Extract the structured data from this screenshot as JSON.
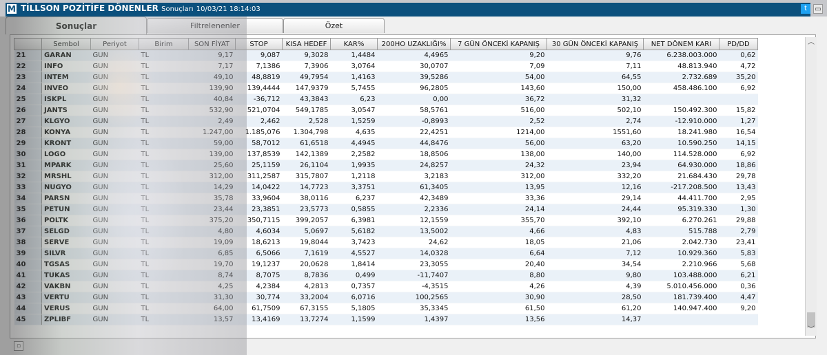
{
  "window": {
    "logo": "M",
    "title": "TİLLSON POZİTİFE DÖNENLER",
    "subtitle": "Sonuçları",
    "datetime": "10/03/21 18:14:03",
    "twitter_icon": "twitter-icon",
    "minimize_icon": "minimize-icon"
  },
  "tabs": [
    {
      "label": "Sonuçlar",
      "active": true
    },
    {
      "label": "Filtrelenenler",
      "active": false
    },
    {
      "label": "Özet",
      "active": false
    }
  ],
  "table": {
    "columns": [
      "",
      "Sembol",
      "Periyot",
      "Birim",
      "SON FİYAT",
      "STOP",
      "KISA HEDEF",
      "KAR%",
      "200HO UZAKLIĞI%",
      "7 GÜN ÖNCEKİ KAPANIŞ",
      "30 GÜN ÖNCEKİ KAPANIŞ",
      "NET DÖNEM KARI",
      "PD/DD"
    ],
    "rows": [
      [
        "21",
        "GARAN",
        "GUN",
        "TL",
        "9,17",
        "9,087",
        "9,3028",
        "1,4484",
        "4,4965",
        "9,20",
        "9,76",
        "6.238.003.000",
        "0,62"
      ],
      [
        "22",
        "INFO",
        "GUN",
        "TL",
        "7,17",
        "7,1386",
        "7,3906",
        "3,0764",
        "30,0707",
        "7,09",
        "7,11",
        "48.813.940",
        "4,72"
      ],
      [
        "23",
        "INTEM",
        "GUN",
        "TL",
        "49,10",
        "48,8819",
        "49,7954",
        "1,4163",
        "39,5286",
        "54,00",
        "64,55",
        "2.732.689",
        "35,20"
      ],
      [
        "24",
        "INVEO",
        "GUN",
        "TL",
        "139,90",
        "139,4444",
        "147,9379",
        "5,7455",
        "96,2805",
        "143,60",
        "150,00",
        "458.486.100",
        "6,92"
      ],
      [
        "25",
        "ISKPL",
        "GUN",
        "TL",
        "40,84",
        "-36,712",
        "43,3843",
        "6,23",
        "0,00",
        "36,72",
        "31,32",
        "",
        ""
      ],
      [
        "26",
        "JANTS",
        "GUN",
        "TL",
        "532,90",
        "521,0704",
        "549,1785",
        "3,0547",
        "58,5761",
        "516,00",
        "502,10",
        "150.492.300",
        "15,82"
      ],
      [
        "27",
        "KLGYO",
        "GUN",
        "TL",
        "2,49",
        "2,462",
        "2,528",
        "1,5259",
        "-0,8993",
        "2,52",
        "2,74",
        "-12.910.000",
        "1,27"
      ],
      [
        "28",
        "KONYA",
        "GUN",
        "TL",
        "1.247,00",
        "1.185,076",
        "1.304,798",
        "4,635",
        "22,4251",
        "1214,00",
        "1551,60",
        "18.241.980",
        "16,54"
      ],
      [
        "29",
        "KRONT",
        "GUN",
        "TL",
        "59,00",
        "58,7012",
        "61,6518",
        "4,4945",
        "44,8476",
        "56,00",
        "63,20",
        "10.590.250",
        "14,15"
      ],
      [
        "30",
        "LOGO",
        "GUN",
        "TL",
        "139,00",
        "137,8539",
        "142,1389",
        "2,2582",
        "18,8506",
        "138,00",
        "140,00",
        "114.528.000",
        "6,92"
      ],
      [
        "31",
        "MPARK",
        "GUN",
        "TL",
        "25,60",
        "25,1159",
        "26,1104",
        "1,9935",
        "24,8257",
        "24,32",
        "23,94",
        "64.930.000",
        "18,86"
      ],
      [
        "32",
        "MRSHL",
        "GUN",
        "TL",
        "312,00",
        "311,2587",
        "315,7807",
        "1,2118",
        "3,2183",
        "312,00",
        "332,20",
        "21.684.430",
        "29,78"
      ],
      [
        "33",
        "NUGYO",
        "GUN",
        "TL",
        "14,29",
        "14,0422",
        "14,7723",
        "3,3751",
        "61,3405",
        "13,95",
        "12,16",
        "-217.208.500",
        "13,43"
      ],
      [
        "34",
        "PARSN",
        "GUN",
        "TL",
        "35,78",
        "33,9604",
        "38,0116",
        "6,237",
        "42,3489",
        "33,36",
        "29,14",
        "44.411.700",
        "2,95"
      ],
      [
        "35",
        "PETUN",
        "GUN",
        "TL",
        "23,44",
        "23,3851",
        "23,5773",
        "0,5855",
        "2,2336",
        "24,14",
        "24,44",
        "95.319.330",
        "1,30"
      ],
      [
        "36",
        "POLTK",
        "GUN",
        "TL",
        "375,20",
        "350,7115",
        "399,2057",
        "6,3981",
        "12,1559",
        "355,70",
        "392,10",
        "6.270.261",
        "29,88"
      ],
      [
        "37",
        "SELGD",
        "GUN",
        "TL",
        "4,80",
        "4,6034",
        "5,0697",
        "5,6182",
        "13,5002",
        "4,66",
        "4,83",
        "515.788",
        "2,79"
      ],
      [
        "38",
        "SERVE",
        "GUN",
        "TL",
        "19,09",
        "18,6213",
        "19,8044",
        "3,7423",
        "24,62",
        "18,05",
        "21,06",
        "2.042.730",
        "23,41"
      ],
      [
        "39",
        "SILVR",
        "GUN",
        "TL",
        "6,85",
        "6,5066",
        "7,1619",
        "4,5527",
        "14,0328",
        "6,64",
        "7,12",
        "10.929.360",
        "5,83"
      ],
      [
        "40",
        "TGSAS",
        "GUN",
        "TL",
        "19,70",
        "19,1237",
        "20,0628",
        "1,8414",
        "23,3055",
        "20,40",
        "34,54",
        "2.210.966",
        "5,68"
      ],
      [
        "41",
        "TUKAS",
        "GUN",
        "TL",
        "8,74",
        "8,7075",
        "8,7836",
        "0,499",
        "-11,7407",
        "8,80",
        "9,80",
        "103.488.000",
        "6,21"
      ],
      [
        "42",
        "VAKBN",
        "GUN",
        "TL",
        "4,25",
        "4,2384",
        "4,2813",
        "0,7357",
        "-4,3515",
        "4,26",
        "4,39",
        "5.010.456.000",
        "0,36"
      ],
      [
        "43",
        "VERTU",
        "GUN",
        "TL",
        "31,30",
        "30,774",
        "33,2004",
        "6,0716",
        "100,2565",
        "30,90",
        "28,50",
        "181.739.400",
        "4,47"
      ],
      [
        "44",
        "VERUS",
        "GUN",
        "TL",
        "64,00",
        "61,7509",
        "67,3155",
        "5,1805",
        "35,3345",
        "61,50",
        "61,20",
        "140.947.400",
        "9,20"
      ],
      [
        "45",
        "ZPLIBF",
        "GUN",
        "TL",
        "13,57",
        "13,4169",
        "13,7274",
        "1,1599",
        "1,4397",
        "13,56",
        "14,37",
        "",
        ""
      ]
    ]
  },
  "scrollbar": {
    "up_icon": "chevron-up-icon",
    "down_icon": "chevron-down-icon"
  },
  "statusbar": {
    "corner_icon": "resize-grip-icon"
  }
}
